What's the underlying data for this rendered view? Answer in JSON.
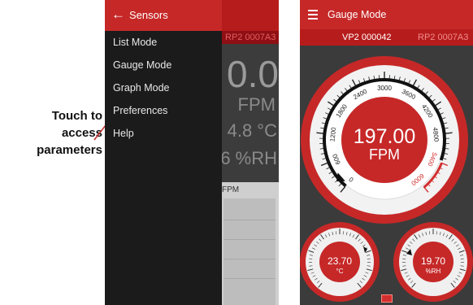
{
  "callout": {
    "line1": "Touch to",
    "line2": "access",
    "line3": "parameters"
  },
  "left_screen": {
    "drawer_title": "Sensors",
    "back_icon": "arrow-left-icon",
    "menu": [
      {
        "label": "List Mode"
      },
      {
        "label": "Gauge Mode"
      },
      {
        "label": "Graph Mode"
      },
      {
        "label": "Preferences"
      },
      {
        "label": "Help"
      }
    ],
    "background": {
      "device_tab": "RP2 0007A3",
      "value": "0.0",
      "unit": "FPM",
      "temperature": "4.8 °C",
      "humidity": "6 %RH",
      "graph_label": "FPM"
    }
  },
  "right_screen": {
    "title": "Gauge Mode",
    "menu_icon": "hamburger-menu-icon",
    "tabs": [
      {
        "label": "VP2 000042",
        "active": true
      },
      {
        "label": "RP2 0007A3",
        "active": false
      }
    ],
    "main_gauge": {
      "value": "197.00",
      "unit": "FPM",
      "reading": 197,
      "scale_max": 6000,
      "scale_labels": [
        "0",
        "600",
        "1200",
        "1800",
        "2400",
        "3000",
        "3600",
        "4200",
        "4800",
        "5400",
        "6000"
      ]
    },
    "temp_gauge": {
      "value": "23.70",
      "unit": "°C"
    },
    "rh_gauge": {
      "value": "19.70",
      "unit": "%RH"
    }
  },
  "colors": {
    "accent_red": "#c62828",
    "dark_red": "#b71c1c",
    "panel": "#3b3b3b",
    "drawer": "#1b1b1b"
  }
}
